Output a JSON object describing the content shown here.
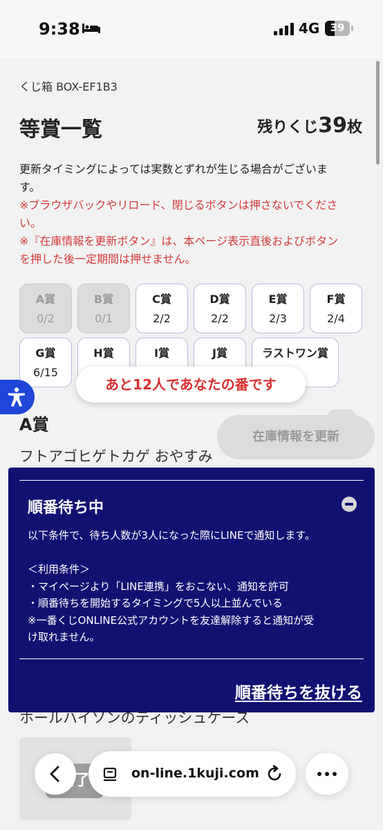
{
  "status_bar": {
    "time": "9:38",
    "network": "4G",
    "battery_level": "39",
    "battery_fraction": 0.39
  },
  "header": {
    "breadcrumb": "くじ箱 BOX-EF1B3",
    "title": "等賞一覧",
    "remaining_label": "残りくじ",
    "remaining_count": "39",
    "remaining_unit": "枚"
  },
  "notice": {
    "line1": "更新タイミングによっては実数とずれが生じる場合がございま",
    "line2": "す。",
    "red_line1": "※ブラウザバックやリロード、閉じるボタンは押さないでくださ",
    "red_line2": "い。",
    "red_line3": "※『在庫情報を更新ボタン』は、本ページ表示直後およびボタン",
    "red_line4": "を押した後一定期間は押せません。"
  },
  "prizes": [
    {
      "name": "A賞",
      "count": "0/2",
      "sold_out": true
    },
    {
      "name": "B賞",
      "count": "0/1",
      "sold_out": true
    },
    {
      "name": "C賞",
      "count": "2/2",
      "sold_out": false
    },
    {
      "name": "D賞",
      "count": "2/2",
      "sold_out": false
    },
    {
      "name": "E賞",
      "count": "2/3",
      "sold_out": false
    },
    {
      "name": "F賞",
      "count": "2/4",
      "sold_out": false
    },
    {
      "name": "G賞",
      "count": "6/15",
      "sold_out": false
    },
    {
      "name": "H賞",
      "count": "",
      "sold_out": false
    },
    {
      "name": "I賞",
      "count": "",
      "sold_out": false
    },
    {
      "name": "J賞",
      "count": "",
      "sold_out": false
    },
    {
      "name": "ラストワン賞",
      "count": "",
      "sold_out": false
    }
  ],
  "queue_toast": "あと12人であなたの番です",
  "refresh_button": "在庫情報を更新",
  "section": {
    "title": "A賞",
    "description": "フトアゴヒゲトカゲ おやすみ",
    "next_item": "ホールハイソンのティッシュケース",
    "thumb_overlay": "終了"
  },
  "queue_panel": {
    "title": "順番待ち中",
    "lines": [
      "以下条件で、待ち人数が3人になった際にLINEで通知します。",
      "",
      "＜利用条件＞",
      "・マイページより「LINE連携」をおこない、通知を許可",
      "・順番待ちを開始するタイミングで5人以上並んでいる",
      "※一番くじONLINE公式アカウントを友達解除すると通知が受",
      "け取れません。"
    ],
    "exit_label": "順番待ちを抜ける"
  },
  "browser": {
    "url": "on-line.1kuji.com"
  },
  "icons": {
    "sleep": "bed-icon",
    "signal": "cellular-signal-icon",
    "accessibility": "accessibility-icon",
    "collapse": "minus-circle-icon",
    "back": "chevron-left-icon",
    "page": "page-menu-icon",
    "reload": "reload-icon",
    "more": "more-icon"
  },
  "colors": {
    "panel_bg": "#111172",
    "alert_red": "#d23b3b",
    "accessibility_blue": "#1e46d8"
  }
}
